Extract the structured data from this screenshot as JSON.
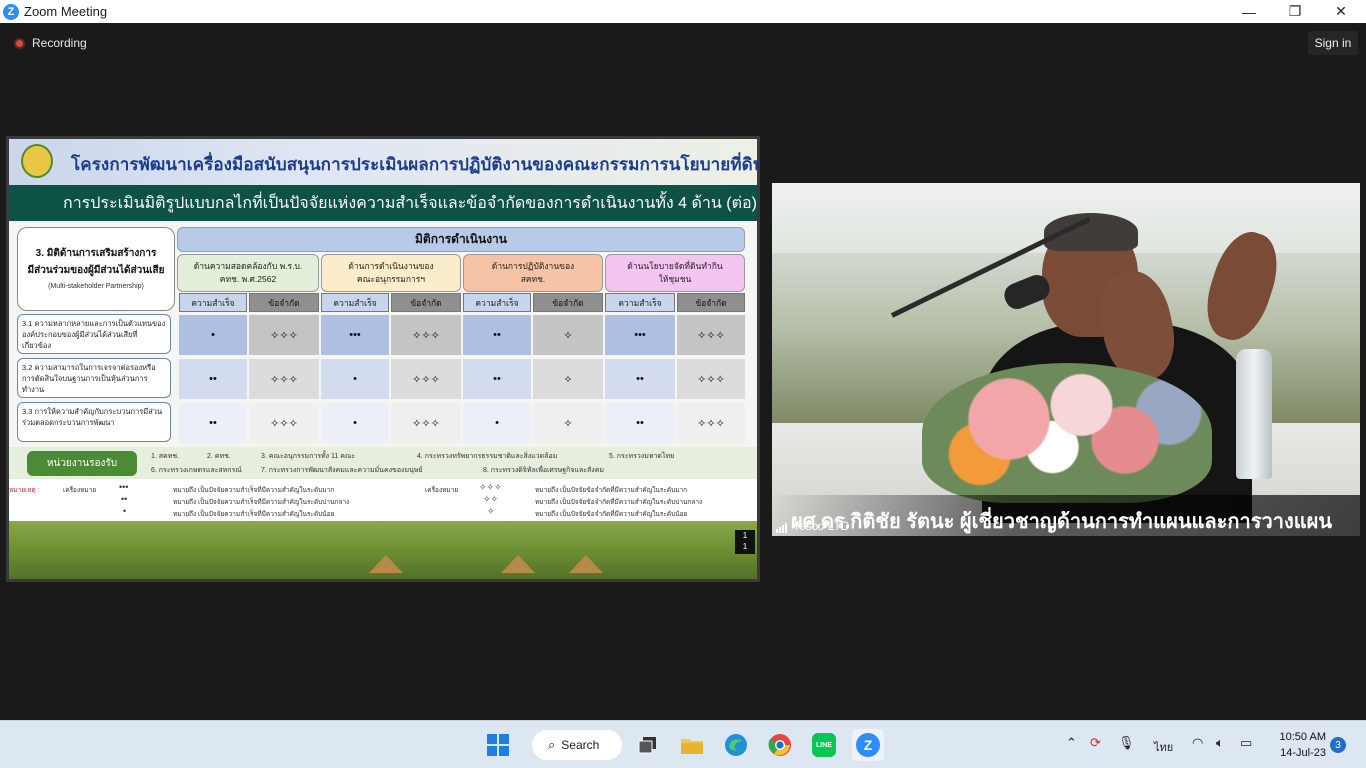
{
  "app": {
    "title": "Zoom Meeting",
    "logo_letter": "Z",
    "minimize": "—",
    "maximize": "❐",
    "close": "✕",
    "brand_color": "#2d8cff"
  },
  "meeting": {
    "recording_label": "Recording",
    "signin_label": "Sign in"
  },
  "slide": {
    "title": "โครงการพัฒนาเครื่องมือสนับสนุนการประเมินผลการปฏิบัติงานของคณะกรรมการนโยบายที่ดินแห่งชาติ",
    "subtitle": "การประเมินมิติรูปแบบกลไกที่เป็นปัจจัยแห่งความสำเร็จและข้อจำกัดของการดำเนินงานทั้ง 4 ด้าน (ต่อ)",
    "dimension": {
      "line1": "3. มิติด้านการเสริมสร้างการ",
      "line2": "มีส่วนร่วมของผู้มีส่วนได้ส่วนเสีย",
      "line3": "(Multi-stakeholder Partnership)"
    },
    "ops_header": "มิติการดำเนินงาน",
    "columns": [
      {
        "title": "ด้านความสอดคล้องกับ พ.ร.บ.",
        "title2": "คทช. พ.ศ.2562",
        "success": "ความสำเร็จ",
        "limit": "ข้อจำกัด",
        "color": "#e3efd8"
      },
      {
        "title": "ด้านการดำเนินงานของ",
        "title2": "คณะอนุกรรมการฯ",
        "success": "ความสำเร็จ",
        "limit": "ข้อจำกัด",
        "color": "#fbedc9"
      },
      {
        "title": "ด้านการปฏิบัติงานของ",
        "title2": "สคทช.",
        "success": "ความสำเร็จ",
        "limit": "ข้อจำกัด",
        "color": "#f6c3a6"
      },
      {
        "title": "ด้านนโยบายจัดที่ดินทำกิน",
        "title2": "ให้ชุมชน",
        "success": "ความสำเร็จ",
        "limit": "ข้อจำกัด",
        "color": "#f3c5f0"
      }
    ],
    "rows": [
      {
        "label": "3.1 ความหลากหลายและการเป็นตัวแทนขององค์ประกอบของผู้มีส่วนได้ส่วนเสียที่เกี่ยวข้อง",
        "cells": [
          "•",
          "✧✧✧",
          "•••",
          "✧✧✧",
          "••",
          "✧",
          "•••",
          "✧✧✧"
        ]
      },
      {
        "label": "3.2 ความสามารถในการเจรจาต่อรองหรือการตัดสินใจบนฐานการเป็นหุ้นส่วนการทำงาน",
        "cells": [
          "••",
          "✧✧✧",
          "•",
          "✧✧✧",
          "••",
          "✧",
          "••",
          "✧✧✧"
        ]
      },
      {
        "label": "3.3 การให้ความสำคัญกับกระบวนการมีส่วนร่วมตลอดกระบวนการพัฒนา",
        "cells": [
          "••",
          "✧✧✧",
          "•",
          "✧✧✧",
          "•",
          "✧",
          "••",
          "✧✧✧"
        ]
      }
    ],
    "agency_label": "หน่วยงานรองรับ",
    "agencies": [
      "1. สคทช.",
      "2. คทช.",
      "3. คณะอนุกรรมการทั้ง 11 คณะ",
      "4. กระทรวงทรัพยากรธรรมชาติและสิ่งแวดล้อม",
      "5. กระทรวงมหาดไทย",
      "6. กระทรวงเกษตรและสหกรณ์",
      "7. กระทรวงการพัฒนาสังคมและความมั่นคงของมนุษย์",
      "8. กระทรวงดิจิทัลเพื่อเศรษฐกิจและสังคม"
    ],
    "legend": {
      "note": "หมายเหตุ :",
      "mark_label": "เครื่องหมาย",
      "dots": [
        "•••",
        "••",
        "•"
      ],
      "dot_meanings": [
        "หมายถึง เป็นปัจจัยความสำเร็จที่มีความสำคัญในระดับมาก",
        "หมายถึง เป็นปัจจัยความสำเร็จที่มีความสำคัญในระดับปานกลาง",
        "หมายถึง เป็นปัจจัยความสำเร็จที่มีความสำคัญในระดับน้อย"
      ],
      "stars": [
        "✧✧✧",
        "✧✧",
        "✧"
      ],
      "star_meanings": [
        "หมายถึง เป็นปัจจัยข้อจำกัดที่มีความสำคัญในระดับมาก",
        "หมายถึง เป็นปัจจัยข้อจำกัดที่มีความสำคัญในระดับปานกลาง",
        "หมายถึง เป็นปัจจัยข้อจำกัดที่มีความสำคัญในระดับน้อย"
      ]
    },
    "page_top": "1",
    "page_bottom": "1"
  },
  "camera": {
    "caption": "ผศ.ดร.กิติชัย รัตนะ ผู้เชี่ยวชาญด้านการทำแผนและการวางแผน",
    "participant_name": "Tesco LTD"
  },
  "taskbar": {
    "search_label": "Search",
    "search_icon": "⌕",
    "apps": [
      "windows-start",
      "task-view",
      "file-explorer",
      "edge",
      "chrome",
      "line",
      "zoom"
    ],
    "language": "ไทย",
    "time": "10:50 AM",
    "date": "14-Jul-23",
    "notification_count": "3",
    "line_label": "LINE"
  }
}
